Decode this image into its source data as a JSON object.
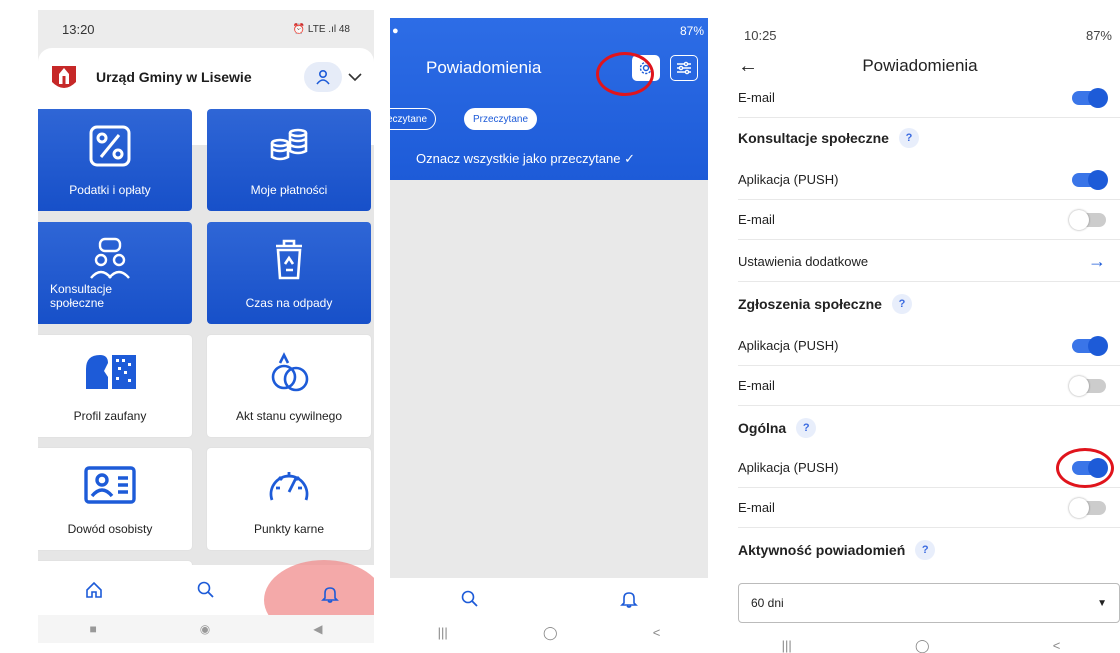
{
  "panel1": {
    "status_time": "13:20",
    "status_icons": "⏰ LTE .ıl 48",
    "org_name": "Urząd Gminy w Lisewie",
    "tiles": [
      {
        "label": "Podatki i opłaty",
        "icon": "percent-icon"
      },
      {
        "label": "Moje płatności",
        "icon": "coins-icon"
      },
      {
        "label": "Konsultacje społeczne",
        "icon": "people-chat-icon"
      },
      {
        "label": "Czas na odpady",
        "icon": "recycle-bin-icon"
      },
      {
        "label": "Profil zaufany",
        "icon": "profile-icon"
      },
      {
        "label": "Akt stanu cywilnego",
        "icon": "rings-icon"
      },
      {
        "label": "Dowód osobisty",
        "icon": "id-card-icon"
      },
      {
        "label": "Punkty karne",
        "icon": "speedometer-icon"
      }
    ]
  },
  "panel2": {
    "status_right": "87%",
    "title": "Powiadomienia",
    "chip_unread": "eczytane",
    "chip_read": "Przeczytane",
    "mark_all": "Oznacz wszystkie jako przeczytane ✓"
  },
  "panel3": {
    "status_time": "10:25",
    "status_right": "87%",
    "title": "Powiadomienia",
    "rows": [
      {
        "label": "E-mail",
        "type": "toggle",
        "on": true
      },
      {
        "label": "Konsultacje społeczne",
        "type": "section"
      },
      {
        "label": "Aplikacja (PUSH)",
        "type": "toggle",
        "on": true
      },
      {
        "label": "E-mail",
        "type": "toggle",
        "on": false
      },
      {
        "label": "Ustawienia dodatkowe",
        "type": "link"
      },
      {
        "label": "Zgłoszenia społeczne",
        "type": "section"
      },
      {
        "label": "Aplikacja (PUSH)",
        "type": "toggle",
        "on": true
      },
      {
        "label": "E-mail",
        "type": "toggle",
        "on": false
      },
      {
        "label": "Ogólna",
        "type": "section"
      },
      {
        "label": "Aplikacja (PUSH)",
        "type": "toggle",
        "on": true
      },
      {
        "label": "E-mail",
        "type": "toggle",
        "on": false
      },
      {
        "label": "Aktywność powiadomień",
        "type": "section"
      }
    ],
    "select_value": "60 dni",
    "help_mark": "?"
  },
  "colors": {
    "accent": "#1d5bd8",
    "highlight": "#e0141c"
  }
}
